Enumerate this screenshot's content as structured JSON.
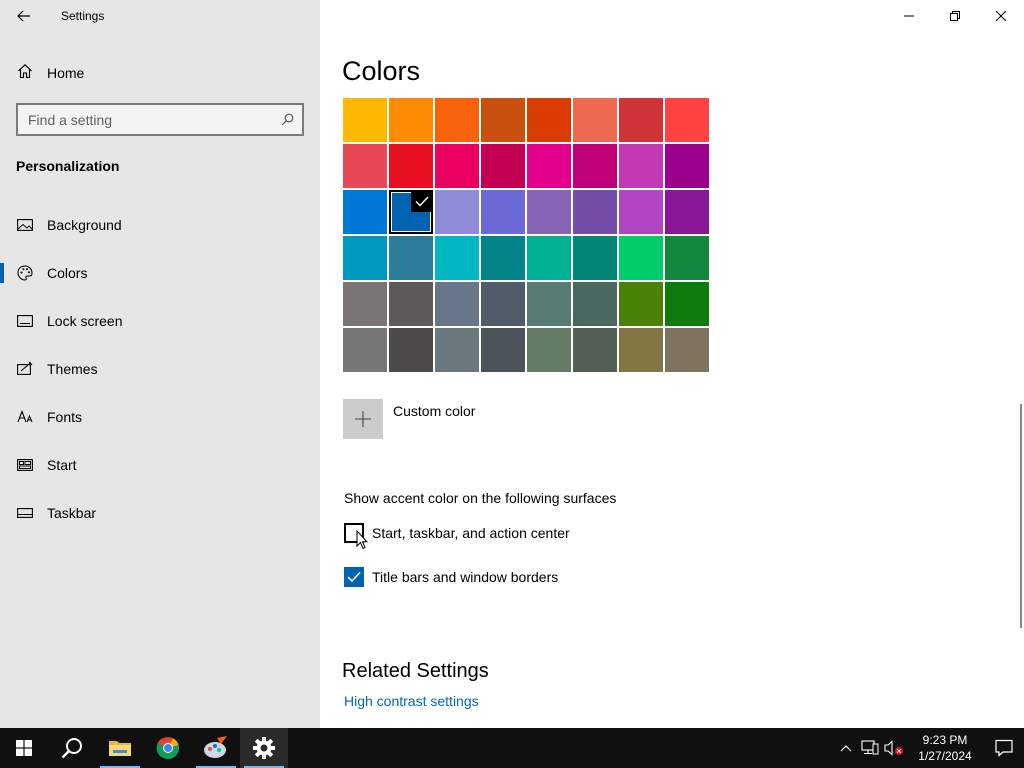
{
  "window": {
    "title": "Settings"
  },
  "sidebar": {
    "home_label": "Home",
    "search_placeholder": "Find a setting",
    "section_title": "Personalization",
    "items": [
      {
        "id": "background",
        "label": "Background",
        "icon": "image-icon"
      },
      {
        "id": "colors",
        "label": "Colors",
        "icon": "palette-icon",
        "active": true
      },
      {
        "id": "lock-screen",
        "label": "Lock screen",
        "icon": "lock-screen-icon"
      },
      {
        "id": "themes",
        "label": "Themes",
        "icon": "themes-icon"
      },
      {
        "id": "fonts",
        "label": "Fonts",
        "icon": "fonts-icon"
      },
      {
        "id": "start",
        "label": "Start",
        "icon": "start-icon"
      },
      {
        "id": "taskbar",
        "label": "Taskbar",
        "icon": "taskbar-icon"
      }
    ]
  },
  "main": {
    "page_title": "Colors",
    "swatches": [
      [
        "#ffb900",
        "#ff8c00",
        "#f7630c",
        "#ca5010",
        "#da3b01",
        "#ef6950",
        "#d13438",
        "#ff4343"
      ],
      [
        "#e74856",
        "#e81123",
        "#ea005e",
        "#c30052",
        "#e3008c",
        "#bf0077",
        "#c239b3",
        "#9a0089"
      ],
      [
        "#0078d7",
        "#0063b1",
        "#8e8cd8",
        "#6b69d6",
        "#8764b8",
        "#744da9",
        "#b146c2",
        "#881798"
      ],
      [
        "#0099bc",
        "#2d7d9a",
        "#00b7c3",
        "#038387",
        "#00b294",
        "#018574",
        "#00cc6a",
        "#10893e"
      ],
      [
        "#7a7574",
        "#5d5a58",
        "#68768a",
        "#515c6b",
        "#567c73",
        "#486860",
        "#498205",
        "#107c10"
      ],
      [
        "#767676",
        "#4c4a48",
        "#69797e",
        "#4a5459",
        "#647c64",
        "#525e54",
        "#847545",
        "#7e735f"
      ]
    ],
    "selected_swatch": {
      "row": 2,
      "col": 1
    },
    "custom_color_label": "Custom color",
    "surfaces_title": "Show accent color on the following surfaces",
    "checkboxes": [
      {
        "label": "Start, taskbar, and action center",
        "checked": false
      },
      {
        "label": "Title bars and window borders",
        "checked": true
      }
    ],
    "related_title": "Related Settings",
    "related_link": "High contrast settings"
  },
  "taskbar": {
    "apps": [
      {
        "name": "start-button",
        "icon": "windows-logo-icon"
      },
      {
        "name": "search-button",
        "icon": "search-icon"
      },
      {
        "name": "file-explorer",
        "icon": "folder-icon",
        "running": true
      },
      {
        "name": "chrome",
        "icon": "chrome-icon"
      },
      {
        "name": "paint",
        "icon": "paint-icon",
        "running": true
      },
      {
        "name": "settings",
        "icon": "gear-icon",
        "running": true
      }
    ],
    "clock_time": "9:23 PM",
    "clock_date": "1/27/2024"
  },
  "colors": {
    "accent": "#0063b1",
    "link": "#0067b8",
    "sidebar_bg": "#e6e6e6",
    "taskbar_bg": "#101010"
  }
}
